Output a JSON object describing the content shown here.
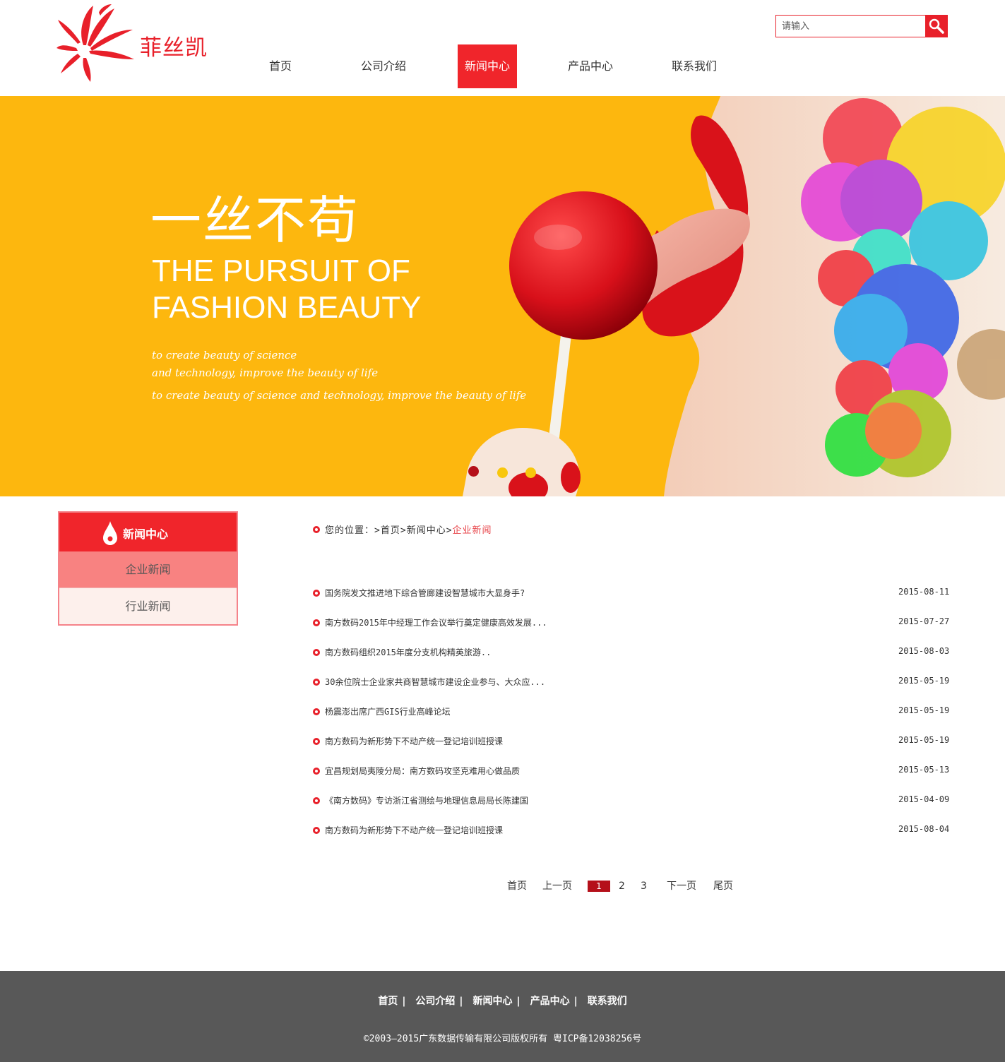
{
  "header": {
    "logo_text": "菲丝凯",
    "search_placeholder": "请输入"
  },
  "nav": {
    "items": [
      {
        "label": "首页"
      },
      {
        "label": "公司介绍"
      },
      {
        "label": "新闻中心",
        "active": true
      },
      {
        "label": "产品中心"
      },
      {
        "label": "联系我们"
      }
    ]
  },
  "banner": {
    "headline": "一丝不苟",
    "subtitle_line1": "THE PURSUIT OF",
    "subtitle_line2": "FASHION BEAUTY",
    "small_line1": "to create beauty of science",
    "small_line2": "and technology, improve the beauty of life",
    "small_line3": "to create beauty of science and technology, improve the beauty of life"
  },
  "sidebar": {
    "title": "新闻中心",
    "items": [
      {
        "label": "企业新闻",
        "active": true
      },
      {
        "label": "行业新闻"
      }
    ]
  },
  "breadcrumb": {
    "prefix": "您的位置：",
    "home": "首页",
    "section": "新闻中心",
    "current": "企业新闻"
  },
  "news": [
    {
      "title": "国务院发文推进地下综合管廊建设智慧城市大显身手?",
      "date": "2015-08-11"
    },
    {
      "title": "南方数码2015年中经理工作会议举行奠定健康高效发展...",
      "date": "2015-07-27"
    },
    {
      "title": "南方数码组织2015年度分支机构精英旅游..",
      "date": "2015-08-03"
    },
    {
      "title": "30余位院士企业家共商智慧城市建设企业参与、大众应...",
      "date": "2015-05-19"
    },
    {
      "title": "杨震澎出席广西GIS行业高峰论坛",
      "date": "2015-05-19"
    },
    {
      "title": "南方数码为新形势下不动产统一登记培训班授课",
      "date": "2015-05-19"
    },
    {
      "title": "宜昌规划局夷陵分局：南方数码攻坚克难用心做品质",
      "date": "2015-05-13"
    },
    {
      "title": "《南方数码》专访浙江省测绘与地理信息局局长陈建国",
      "date": "2015-04-09"
    },
    {
      "title": "南方数码为新形势下不动产统一登记培训班授课",
      "date": "2015-08-04"
    }
  ],
  "pagination": {
    "first": "首页",
    "prev": "上一页",
    "pages": [
      "1",
      "2",
      "3"
    ],
    "current": "1",
    "next": "下一页",
    "last": "尾页"
  },
  "footer": {
    "nav": [
      "首页",
      "公司介绍",
      "新闻中心",
      "产品中心",
      "联系我们"
    ],
    "separator": "|",
    "copyright": "©2003—2015广东数据传输有限公司版权所有  粤ICP备12038256号"
  },
  "colors": {
    "accent": "#f0252b",
    "banner_bg": "#fdb70e",
    "footer_bg": "#585858",
    "pagination_current": "#b5101a"
  },
  "icons": {
    "search": "search-icon",
    "bullet": "bullet-icon",
    "sidebar": "drop-icon"
  }
}
